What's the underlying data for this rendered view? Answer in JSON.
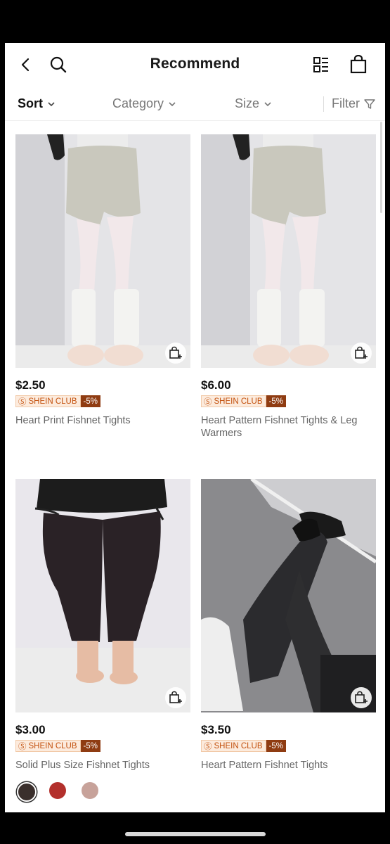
{
  "header": {
    "title": "Recommend"
  },
  "filters": {
    "sort": "Sort",
    "category": "Category",
    "size": "Size",
    "filter": "Filter"
  },
  "products": [
    {
      "price": "$2.50",
      "club_label": "SHEIN CLUB",
      "discount": "-5%",
      "name": "Heart Print Fishnet Tights",
      "swatches": [
        "#ffffff",
        "#000000"
      ]
    },
    {
      "price": "$6.00",
      "club_label": "SHEIN CLUB",
      "discount": "-5%",
      "name": "Heart Pattern Fishnet Tights & Leg Warmers",
      "swatches": []
    },
    {
      "price": "$3.00",
      "club_label": "SHEIN CLUB",
      "discount": "-5%",
      "name": "Solid Plus Size Fishnet Tights",
      "swatches": [
        "#3a2f2c",
        "#b3302c",
        "#c7a29a"
      ]
    },
    {
      "price": "$3.50",
      "club_label": "SHEIN CLUB",
      "discount": "-5%",
      "name": "Heart Pattern Fishnet Tights",
      "swatches": []
    }
  ]
}
